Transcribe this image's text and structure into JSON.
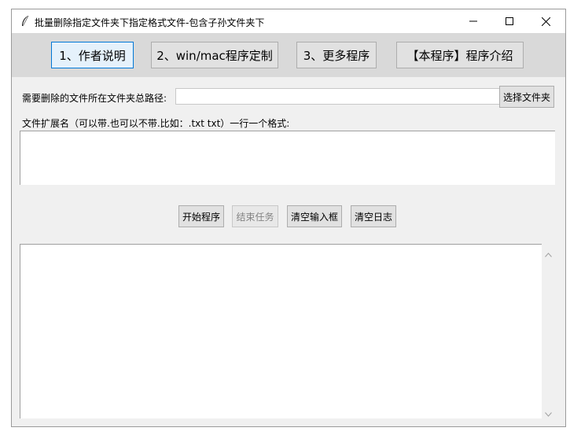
{
  "window": {
    "title": "批量删除指定文件夹下指定格式文件-包含子孙文件夹下",
    "icon": "feather-icon",
    "controls": [
      "minimize-icon",
      "maximize-icon",
      "close-icon"
    ]
  },
  "topbar": {
    "buttons": [
      {
        "label": "1、作者说明"
      },
      {
        "label": "2、win/mac程序定制"
      },
      {
        "label": "3、更多程序"
      },
      {
        "label": "【本程序】程序介绍"
      }
    ],
    "active_color": "#e5f1fb"
  },
  "path": {
    "label": "需要删除的文件所在文件夹总路径:",
    "value": "",
    "select_button": "选择文件夹"
  },
  "ext": {
    "label": "文件扩展名（可以带.也可以不带.比如：.txt  txt）一行一个格式:",
    "value": ""
  },
  "actions": {
    "start": "开始程序",
    "stop": "结束任务",
    "clear_input": "清空输入框",
    "clear_log": "清空日志"
  },
  "log": {
    "value": ""
  }
}
